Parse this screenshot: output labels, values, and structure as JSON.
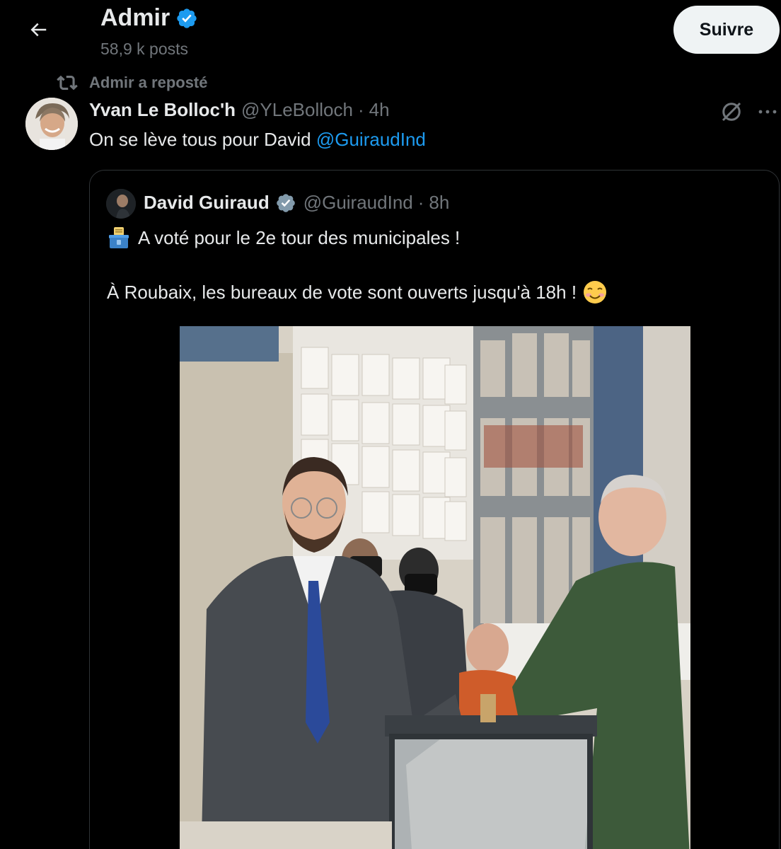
{
  "header": {
    "name": "Admir",
    "posts_count": "58,9 k posts",
    "follow_label": "Suivre"
  },
  "repost": {
    "label": "Admir a reposté"
  },
  "tweet": {
    "author_name": "Yvan Le Bolloc'h",
    "handle": "@YLeBolloch",
    "separator": "·",
    "time": "4h",
    "text": "On se lève tous pour David",
    "mention": "@GuiraudInd"
  },
  "quote": {
    "author_name": "David Guiraud",
    "handle": "@GuiraudInd",
    "separator": "·",
    "time": "8h",
    "line1": "A voté pour le 2e tour des municipales !",
    "line2": "À Roubaix, les bureaux de vote sont ouverts jusqu'à 18h !",
    "line1_emoji": "ballot-box-emoji",
    "line2_emoji": "smiling-face-emoji"
  },
  "icons": {
    "back": "arrow-left-icon",
    "verified": "verified-badge-icon",
    "repost": "repost-icon",
    "grok": "grok-icon",
    "more": "more-icon"
  },
  "colors": {
    "background": "#000000",
    "text": "#e7e9ea",
    "muted": "#71767b",
    "link": "#1d9bf0",
    "verified": "#1d9bf0",
    "border": "#2f3336",
    "follow_bg": "#eff3f4"
  }
}
